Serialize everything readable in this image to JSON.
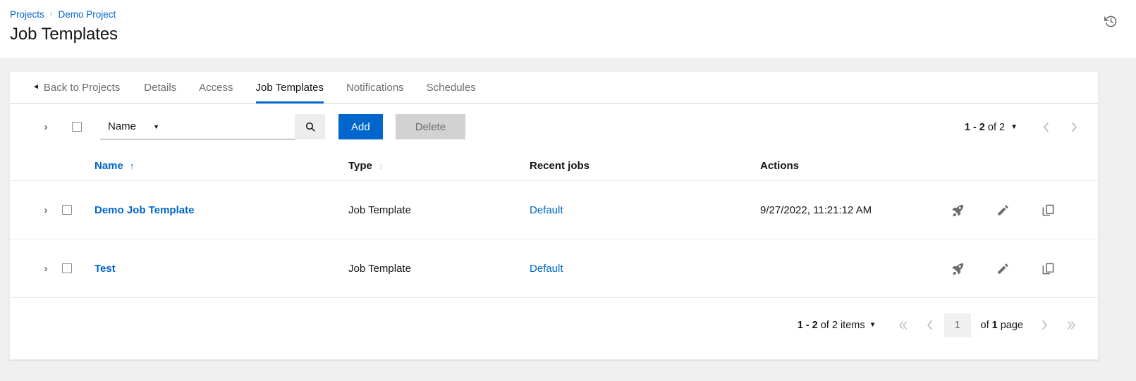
{
  "breadcrumb": {
    "items": [
      {
        "label": "Projects"
      },
      {
        "label": "Demo Project"
      }
    ],
    "separator": "›"
  },
  "header": {
    "title": "Job Templates",
    "history_icon": "history-icon"
  },
  "tabs": [
    {
      "label": "Back to Projects",
      "name": "tab-back-to-projects",
      "active": false,
      "back": true
    },
    {
      "label": "Details",
      "name": "tab-details",
      "active": false
    },
    {
      "label": "Access",
      "name": "tab-access",
      "active": false
    },
    {
      "label": "Job Templates",
      "name": "tab-job-templates",
      "active": true
    },
    {
      "label": "Notifications",
      "name": "tab-notifications",
      "active": false
    },
    {
      "label": "Schedules",
      "name": "tab-schedules",
      "active": false
    }
  ],
  "toolbar": {
    "expand_icon": "chevron-right-icon",
    "select_all_checkbox": "",
    "filter_select": {
      "value": "Name",
      "caret": "▼"
    },
    "search": {
      "value": "",
      "placeholder": ""
    },
    "search_icon": "search-icon",
    "add_label": "Add",
    "delete_label": "Delete"
  },
  "top_pagination": {
    "range_prefix": "1 - 2",
    "range_suffix": " of 2",
    "caret": "▼",
    "prev_icon": "chevron-left-icon",
    "next_icon": "chevron-right-icon"
  },
  "table": {
    "headers": {
      "name": "Name",
      "type": "Type",
      "recent_jobs": "Recent jobs",
      "actions": "Actions"
    },
    "sort": {
      "name_indicator": "↑",
      "type_indicator": "↕"
    },
    "rows": [
      {
        "expand_icon": "chevron-right-icon",
        "name": "Demo Job Template",
        "type": "Job Template",
        "recent_job": "Default",
        "date": "9/27/2022, 11:21:12 AM",
        "actions": [
          "launch-rocket-icon",
          "edit-pencil-icon",
          "copy-icon"
        ]
      },
      {
        "expand_icon": "chevron-right-icon",
        "name": "Test",
        "type": "Job Template",
        "recent_job": "Default",
        "date": "",
        "actions": [
          "launch-rocket-icon",
          "edit-pencil-icon",
          "copy-icon"
        ]
      }
    ]
  },
  "bottom_pagination": {
    "range_prefix": "1 - 2",
    "range_suffix": " of 2",
    "items_label": " items",
    "caret": "▼",
    "first_icon": "angle-double-left-icon",
    "prev_icon": "angle-left-icon",
    "page_value": "1",
    "of_pages_prefix": "of ",
    "of_pages_count": "1",
    "of_pages_suffix": " page",
    "next_icon": "angle-right-icon",
    "last_icon": "angle-double-right-icon"
  },
  "colors": {
    "link": "#0066cc",
    "primary_button": "#0066cc",
    "disabled_button": "#d2d2d2",
    "text": "#151515",
    "muted": "#6a6e73",
    "page_background": "#f0f0f0"
  }
}
